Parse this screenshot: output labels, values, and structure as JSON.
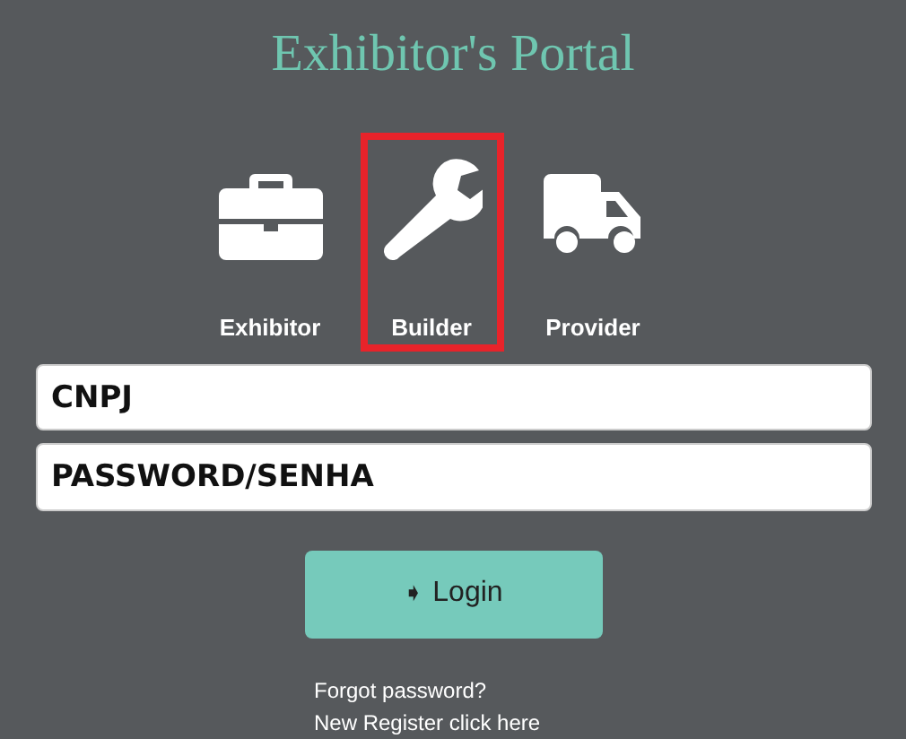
{
  "title": "Exhibitor's Portal",
  "roles": [
    {
      "kind": "briefcase",
      "label": "Exhibitor",
      "selected": false
    },
    {
      "kind": "wrench",
      "label": "Builder",
      "selected": true
    },
    {
      "kind": "truck",
      "label": "Provider",
      "selected": false
    }
  ],
  "fields": [
    {
      "placeholder": "CNPJ"
    },
    {
      "placeholder": "PASSWORD/SENHA"
    }
  ],
  "login_button": {
    "icon": "➧",
    "label": "Login"
  },
  "links": [
    "Forgot password?",
    "New Register click here"
  ]
}
